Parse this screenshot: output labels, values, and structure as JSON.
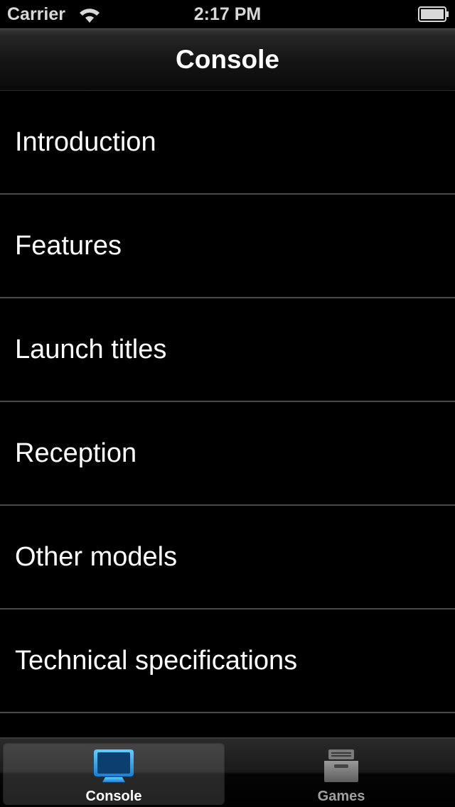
{
  "status_bar": {
    "carrier": "Carrier",
    "time": "2:17 PM",
    "wifi_icon": "wifi-icon",
    "battery_icon": "battery-icon"
  },
  "nav_bar": {
    "title": "Console"
  },
  "list": {
    "items": [
      {
        "label": "Introduction"
      },
      {
        "label": "Features"
      },
      {
        "label": "Launch titles"
      },
      {
        "label": "Reception"
      },
      {
        "label": "Other models"
      },
      {
        "label": "Technical specifications"
      },
      {
        "label": ""
      }
    ]
  },
  "tab_bar": {
    "tabs": [
      {
        "label": "Console",
        "icon": "tv-screen-icon",
        "selected": true
      },
      {
        "label": "Games",
        "icon": "archive-box-icon",
        "selected": false
      }
    ]
  },
  "colors": {
    "background": "#000000",
    "separator": "#4a4a4a",
    "text": "#ffffff",
    "tab_selected_accent": "#2aa8f0",
    "tab_unselected": "#a0a0a0"
  }
}
